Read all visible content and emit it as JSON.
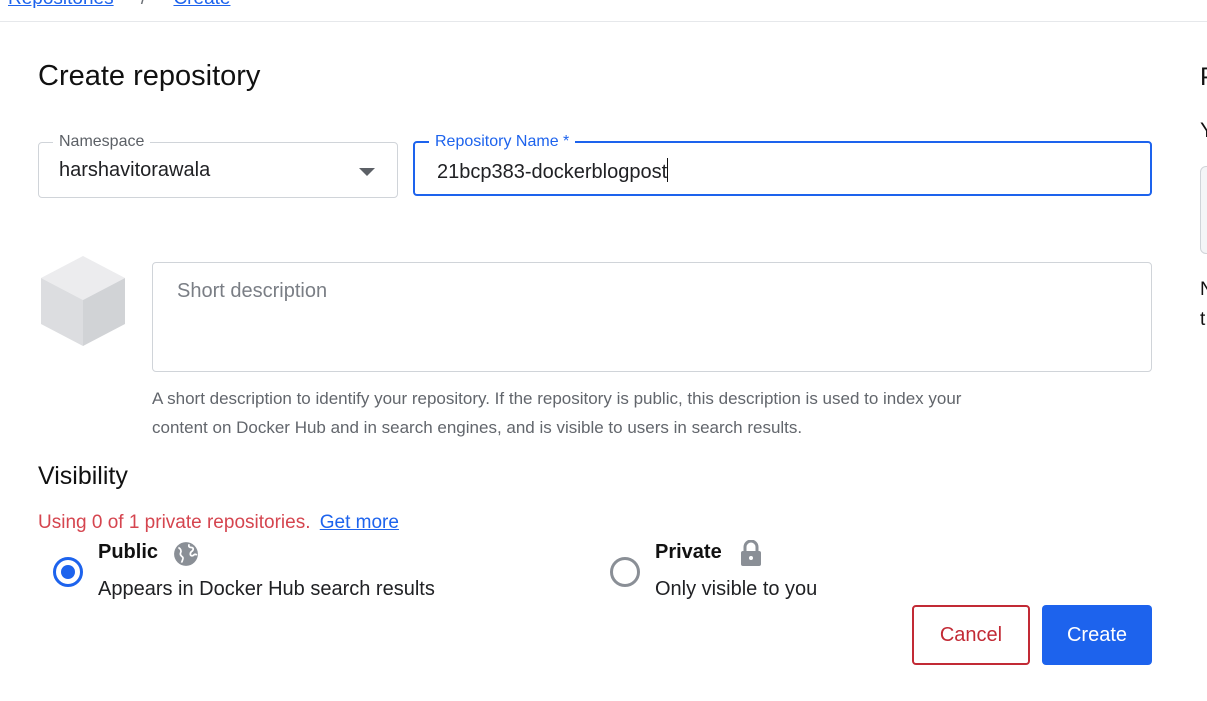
{
  "breadcrumb": {
    "parent": "Repositories",
    "separator": "/",
    "current": "Create"
  },
  "page_title": "Create repository",
  "namespace": {
    "label": "Namespace",
    "value": "harshavitorawala"
  },
  "repo_name": {
    "label": "Repository Name *",
    "value": "21bcp383-dockerblogpost"
  },
  "description": {
    "placeholder": "Short description",
    "help_line1": "A short description to identify your repository. If the repository is public, this description is used to index your",
    "help_line2": "content on Docker Hub and in search engines, and is visible to users in search results."
  },
  "visibility": {
    "title": "Visibility",
    "usage_text": "Using 0 of 1 private repositories.",
    "get_more": "Get more",
    "selected": "public",
    "public": {
      "label": "Public",
      "sub": "Appears in Docker Hub search results",
      "icon": "globe-icon"
    },
    "private": {
      "label": "Private",
      "sub": "Only visible to you",
      "icon": "lock-icon"
    }
  },
  "actions": {
    "cancel": "Cancel",
    "create": "Create"
  },
  "right_column": {
    "heading_partial": "P",
    "line1": "Y",
    "line2": "N",
    "line3": "t"
  },
  "colors": {
    "accent": "#1d63ed",
    "danger": "#c22a35",
    "warning_text": "#d5454f"
  }
}
